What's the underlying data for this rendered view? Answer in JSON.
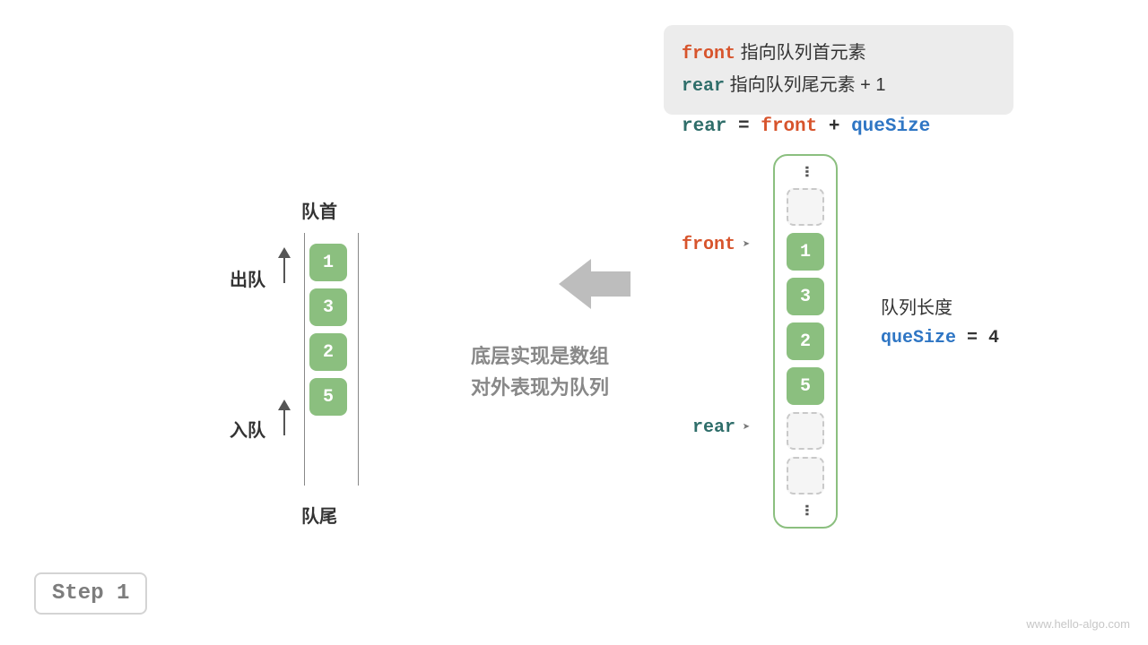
{
  "colors": {
    "front": "#d7542c",
    "rear": "#2f6e6a",
    "queSize": "#2f76c4",
    "cellGreen": "#8bbf7f",
    "muted": "#888888"
  },
  "legend": {
    "front_kw": "front",
    "front_txt": "指向队列首元素",
    "rear_kw": "rear",
    "rear_txt": "指向队列尾元素 + 1"
  },
  "formula": {
    "rear": "rear",
    "eq": " = ",
    "front": "front",
    "plus": " + ",
    "queSize": "queSize"
  },
  "queueLeft": {
    "head_label": "队首",
    "tail_label": "队尾",
    "dequeue_label": "出队",
    "enqueue_label": "入队",
    "items": [
      "1",
      "3",
      "2",
      "5"
    ]
  },
  "center": {
    "line1": "底层实现是数组",
    "line2": "对外表现为队列"
  },
  "array": {
    "front_kw": "front",
    "rear_kw": "rear",
    "filled": [
      "1",
      "3",
      "2",
      "5"
    ],
    "empty_before": 1,
    "empty_after": 2
  },
  "queLen": {
    "title": "队列长度",
    "var": "queSize",
    "eq": " = ",
    "val": "4"
  },
  "step": "Step 1",
  "watermark": "www.hello-algo.com"
}
